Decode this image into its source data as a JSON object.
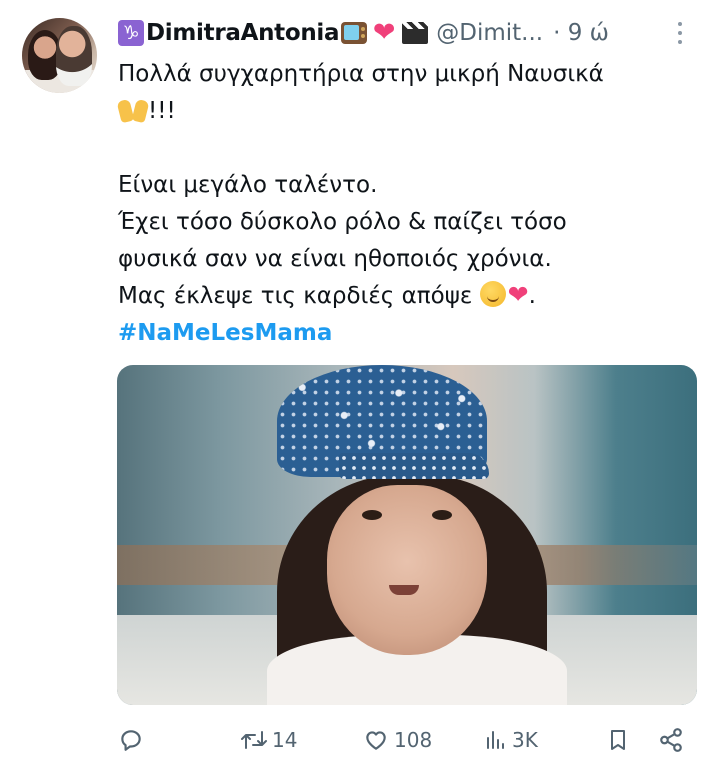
{
  "tweet": {
    "zodiac_sign": "♑",
    "display_name": "DimitraAntonia",
    "handle": "@Dimit...",
    "time": "· 9 ώ",
    "text_lines": [
      "Πολλά συγχαρητήρια στην μικρή Ναυσικά",
      "!!!",
      "Είναι μεγάλο ταλέντο.",
      "Έχει τόσο δύσκολο ρόλο & παίζει τόσο",
      "φυσικά σαν να είναι ηθοποιός χρόνια.",
      "Μας έκλεψε τις καρδιές απόψε",
      "."
    ],
    "hashtag": "#NaMeLesMama",
    "emoji_icons": [
      "capricorn-icon",
      "tv-icon",
      "red-heart-icon",
      "clapper-board-icon",
      "raising-hands-icon",
      "hugging-face-icon",
      "red-heart-icon"
    ],
    "media_icon": "photo-girl-in-floral-cap"
  },
  "actions": {
    "reply": {
      "icon": "reply-icon",
      "count": ""
    },
    "retweet": {
      "icon": "retweet-icon",
      "count": "14"
    },
    "like": {
      "icon": "heart-outline-icon",
      "count": "108"
    },
    "views": {
      "icon": "views-chart-icon",
      "count": "3K"
    },
    "bookmark": {
      "icon": "bookmark-icon",
      "count": ""
    },
    "share": {
      "icon": "share-icon",
      "count": ""
    }
  },
  "colors": {
    "text": "#0f1419",
    "secondary": "#536471",
    "hashtag": "#1d9bf0",
    "heart": "#f0407a"
  }
}
